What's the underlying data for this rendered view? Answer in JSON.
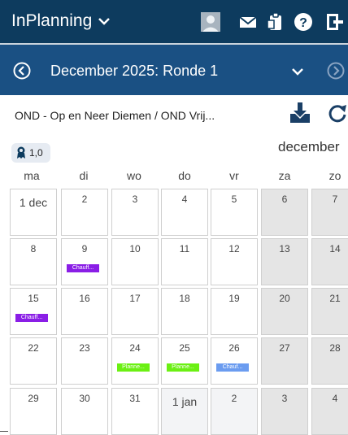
{
  "header": {
    "app_title": "InPlanning",
    "icons": [
      "chevron-down-icon",
      "avatar-icon",
      "mail-icon",
      "clipboard-icon",
      "help-icon",
      "logout-icon"
    ]
  },
  "navigation": {
    "period_title": "December 2025: Ronde 1",
    "icons": [
      "prev-circle-icon",
      "chevron-down-icon",
      "next-circle-icon"
    ]
  },
  "toolbar": {
    "organization": "OND - Op en Neer Diemen / OND Vrij...",
    "icons": [
      "download-icon",
      "refresh-icon"
    ]
  },
  "calendar": {
    "score": "1,0",
    "month_label": "december",
    "weekdays": [
      "ma",
      "di",
      "wo",
      "do",
      "vr",
      "za",
      "zo"
    ],
    "weeks": [
      [
        {
          "label": "1 dec",
          "type": "current"
        },
        {
          "label": "2",
          "type": "current"
        },
        {
          "label": "3",
          "type": "current"
        },
        {
          "label": "4",
          "type": "current"
        },
        {
          "label": "5",
          "type": "current"
        },
        {
          "label": "6",
          "type": "weekend"
        },
        {
          "label": "7",
          "type": "weekend"
        }
      ],
      [
        {
          "label": "8",
          "type": "current"
        },
        {
          "label": "9",
          "type": "current",
          "tag": "Chauff...",
          "tag_color": "#8a1ee6"
        },
        {
          "label": "10",
          "type": "current"
        },
        {
          "label": "11",
          "type": "current"
        },
        {
          "label": "12",
          "type": "current"
        },
        {
          "label": "13",
          "type": "weekend"
        },
        {
          "label": "14",
          "type": "weekend"
        }
      ],
      [
        {
          "label": "15",
          "type": "current",
          "tag": "Chauff...",
          "tag_color": "#8a1ee6"
        },
        {
          "label": "16",
          "type": "current"
        },
        {
          "label": "17",
          "type": "current"
        },
        {
          "label": "18",
          "type": "current"
        },
        {
          "label": "19",
          "type": "current"
        },
        {
          "label": "20",
          "type": "weekend"
        },
        {
          "label": "21",
          "type": "weekend"
        }
      ],
      [
        {
          "label": "22",
          "type": "current"
        },
        {
          "label": "23",
          "type": "current"
        },
        {
          "label": "24",
          "type": "current",
          "tag": "Planne...",
          "tag_color": "#6bf013"
        },
        {
          "label": "25",
          "type": "current",
          "tag": "Planne...",
          "tag_color": "#6bf013"
        },
        {
          "label": "26",
          "type": "current",
          "tag": "Chauf...",
          "tag_color": "#6b9cf0"
        },
        {
          "label": "27",
          "type": "weekend"
        },
        {
          "label": "28",
          "type": "weekend"
        }
      ],
      [
        {
          "label": "29",
          "type": "current"
        },
        {
          "label": "30",
          "type": "current"
        },
        {
          "label": "31",
          "type": "current"
        },
        {
          "label": "1 jan",
          "type": "next"
        },
        {
          "label": "2",
          "type": "next"
        },
        {
          "label": "3",
          "type": "weekend"
        },
        {
          "label": "4",
          "type": "weekend"
        }
      ]
    ]
  },
  "colors": {
    "header_bg": "#0d3b5e",
    "nav_bg": "#1a5083",
    "weekend_bg": "#e5e5e5",
    "tag_purple": "#8a1ee6",
    "tag_green": "#6bf013",
    "tag_blue": "#6b9cf0"
  }
}
